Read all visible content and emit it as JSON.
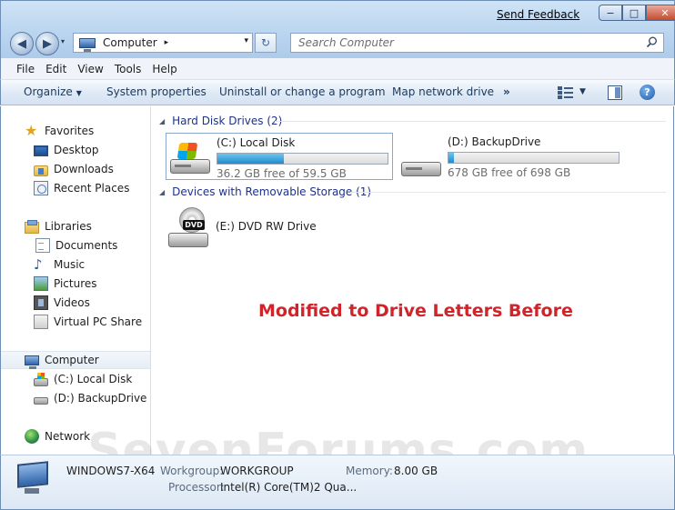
{
  "window": {
    "send_feedback": "Send Feedback",
    "minimize": "−",
    "maximize": "□",
    "close": "✕"
  },
  "address_bar": {
    "back": "◀",
    "forward": "▶",
    "recent": "▾",
    "location": "Computer",
    "separator": "▸",
    "dropdown": "▾",
    "refresh": "↻"
  },
  "search": {
    "placeholder": "Search Computer"
  },
  "menu": [
    "File",
    "Edit",
    "View",
    "Tools",
    "Help"
  ],
  "toolbar": {
    "organize": "Organize",
    "organize_arrow": "▼",
    "system_properties": "System properties",
    "uninstall": "Uninstall or change a program",
    "map_network_drive": "Map network drive",
    "more": "»",
    "view_arrow": "▼",
    "help": "?"
  },
  "nav_pane": {
    "favorites": {
      "label": "Favorites",
      "items": [
        "Desktop",
        "Downloads",
        "Recent Places"
      ]
    },
    "libraries": {
      "label": "Libraries",
      "items": [
        "Documents",
        "Music",
        "Pictures",
        "Videos",
        "Virtual PC Share"
      ]
    },
    "computer": {
      "label": "Computer",
      "items": [
        "(C:) Local Disk",
        "(D:) BackupDrive"
      ]
    },
    "network": {
      "label": "Network"
    }
  },
  "content": {
    "hard_disk_header": "Hard Disk Drives (2)",
    "removable_header": "Devices with Removable Storage (1)",
    "header_arrow": "◢",
    "drives": [
      {
        "name": "(C:) Local Disk",
        "free_text": "36.2 GB free of 59.5 GB",
        "used_fraction": 0.39
      },
      {
        "name": "(D:) BackupDrive",
        "free_text": "678 GB free of 698 GB",
        "used_fraction": 0.03
      }
    ],
    "dvd": {
      "name": "(E:) DVD RW Drive",
      "badge": "DVD"
    },
    "annotation": "Modified to Drive Letters Before",
    "annotation_color": "#d1242a"
  },
  "watermark": "SevenForums.com",
  "details": {
    "computer_name": "WINDOWS7-X64",
    "workgroup_label": "Workgroup:",
    "workgroup_value": "WORKGROUP",
    "memory_label": "Memory:",
    "memory_value": "8.00 GB",
    "processor_label": "Processor:",
    "processor_value": "Intel(R) Core(TM)2 Qua..."
  }
}
